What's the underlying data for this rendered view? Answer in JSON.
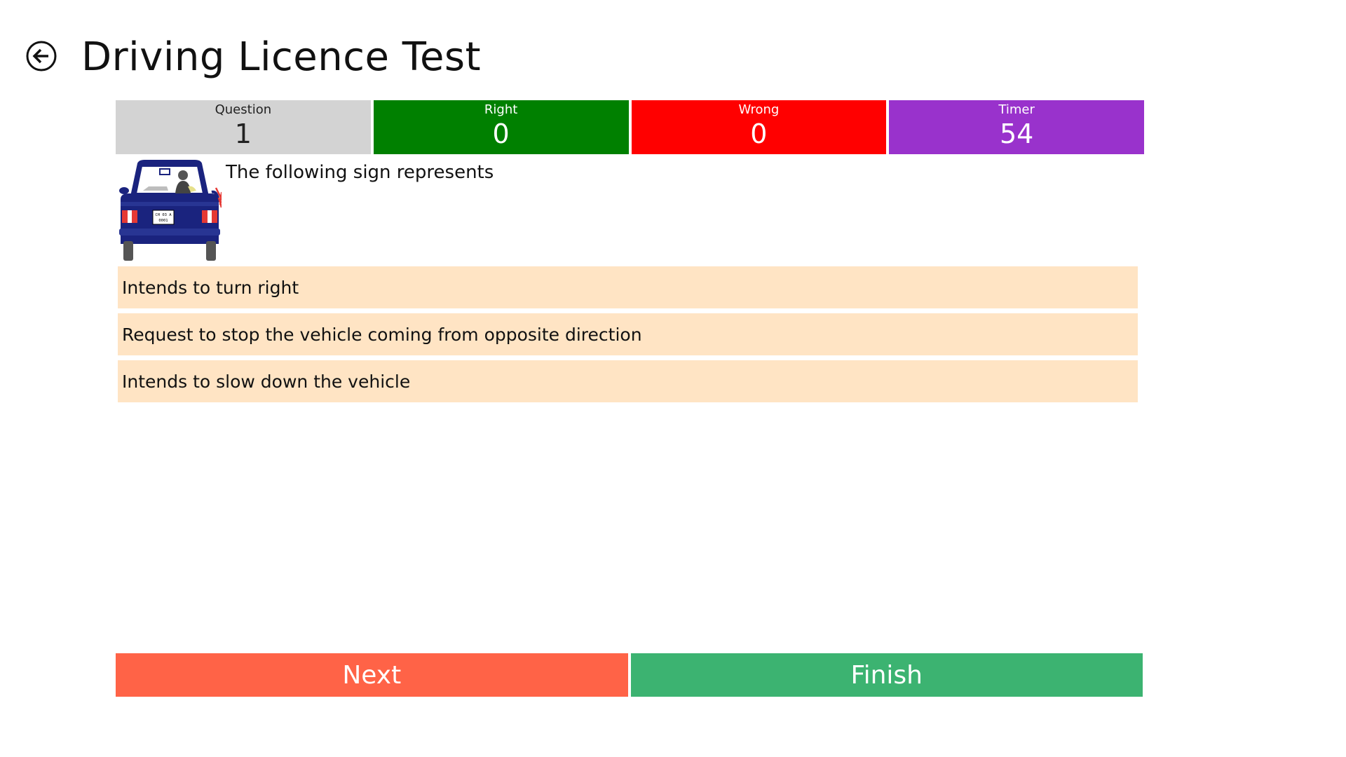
{
  "header": {
    "title": "Driving Licence Test",
    "back_icon": "arrow-left-circle-icon"
  },
  "stats": [
    {
      "label": "Question",
      "value": "1",
      "color": "#d3d3d3"
    },
    {
      "label": "Right",
      "value": "0",
      "color": "#008000"
    },
    {
      "label": "Wrong",
      "value": "0",
      "color": "#ff0000"
    },
    {
      "label": "Timer",
      "value": "54",
      "color": "#9932cc"
    }
  ],
  "question": {
    "text": "The following sign represents",
    "image_name": "car-hand-signal-image",
    "plate_line1": "CH 03 A",
    "plate_line2": "0001"
  },
  "options": [
    {
      "text": "Intends to turn right"
    },
    {
      "text": "Request to stop the vehicle coming from opposite direction"
    },
    {
      "text": "Intends to slow down the vehicle"
    }
  ],
  "option_color": "#ffe4c4",
  "actions": {
    "next_label": "Next",
    "next_color": "#ff6347",
    "finish_label": "Finish",
    "finish_color": "#3cb371"
  }
}
